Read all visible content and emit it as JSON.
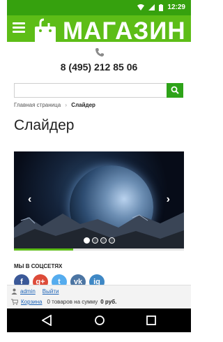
{
  "status_bar": {
    "time": "12:29"
  },
  "header": {
    "logo_text": "МАГАЗИН"
  },
  "contact": {
    "phone": "8 (495) 212 85 06"
  },
  "search": {
    "placeholder": ""
  },
  "breadcrumb": {
    "home": "Главная страница",
    "separator": "›",
    "current": "Слайдер"
  },
  "page": {
    "title": "Слайдер"
  },
  "slider": {
    "prev": "‹",
    "next": "›",
    "slides": 4,
    "active_slide": 1
  },
  "social": {
    "title": "МЫ В СОЦСЕТЯХ",
    "networks": [
      {
        "icon": "f",
        "name": "facebook-icon",
        "color": "#3b5998"
      },
      {
        "icon": "g+",
        "name": "google-plus-icon",
        "color": "#dd4b39"
      },
      {
        "icon": "t",
        "name": "twitter-icon",
        "color": "#55acee"
      },
      {
        "icon": "vk",
        "name": "vk-icon",
        "color": "#4c75a3"
      },
      {
        "icon": "ig",
        "name": "instagram-icon",
        "color": "#3f88c5"
      }
    ]
  },
  "account": {
    "user": "admin",
    "logout": "Выйти",
    "cart": "Корзина",
    "cart_summary": "0 товаров на сумму",
    "cart_amount": "0 руб."
  },
  "colors": {
    "brand_green": "#5dbd17",
    "status_green": "#36a10e",
    "link_blue": "#1c63b7"
  }
}
